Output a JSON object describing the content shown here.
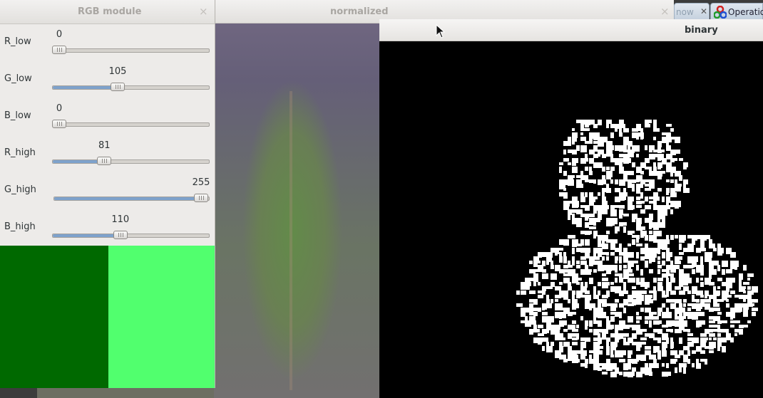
{
  "windows": {
    "normalized": {
      "title": "normalized"
    },
    "binary": {
      "title": "binary"
    },
    "rgb_module": {
      "title": "RGB module"
    }
  },
  "tabs": [
    {
      "label": "now"
    },
    {
      "label": "Operatio"
    }
  ],
  "sliders": [
    {
      "label": "R_low",
      "value": "0",
      "fraction": 0.0
    },
    {
      "label": "G_low",
      "value": "105",
      "fraction": 0.412
    },
    {
      "label": "B_low",
      "value": "0",
      "fraction": 0.0
    },
    {
      "label": "R_high",
      "value": "81",
      "fraction": 0.318
    },
    {
      "label": "G_high",
      "value": "255",
      "fraction": 1.0
    },
    {
      "label": "B_high",
      "value": "110",
      "fraction": 0.431
    }
  ],
  "swatches": {
    "low_color": "#006900",
    "high_color": "#51ff6e"
  },
  "icons": {
    "close": "close-icon",
    "cursor": "mouse-pointer-icon",
    "app": "opencv-logo-icon"
  }
}
